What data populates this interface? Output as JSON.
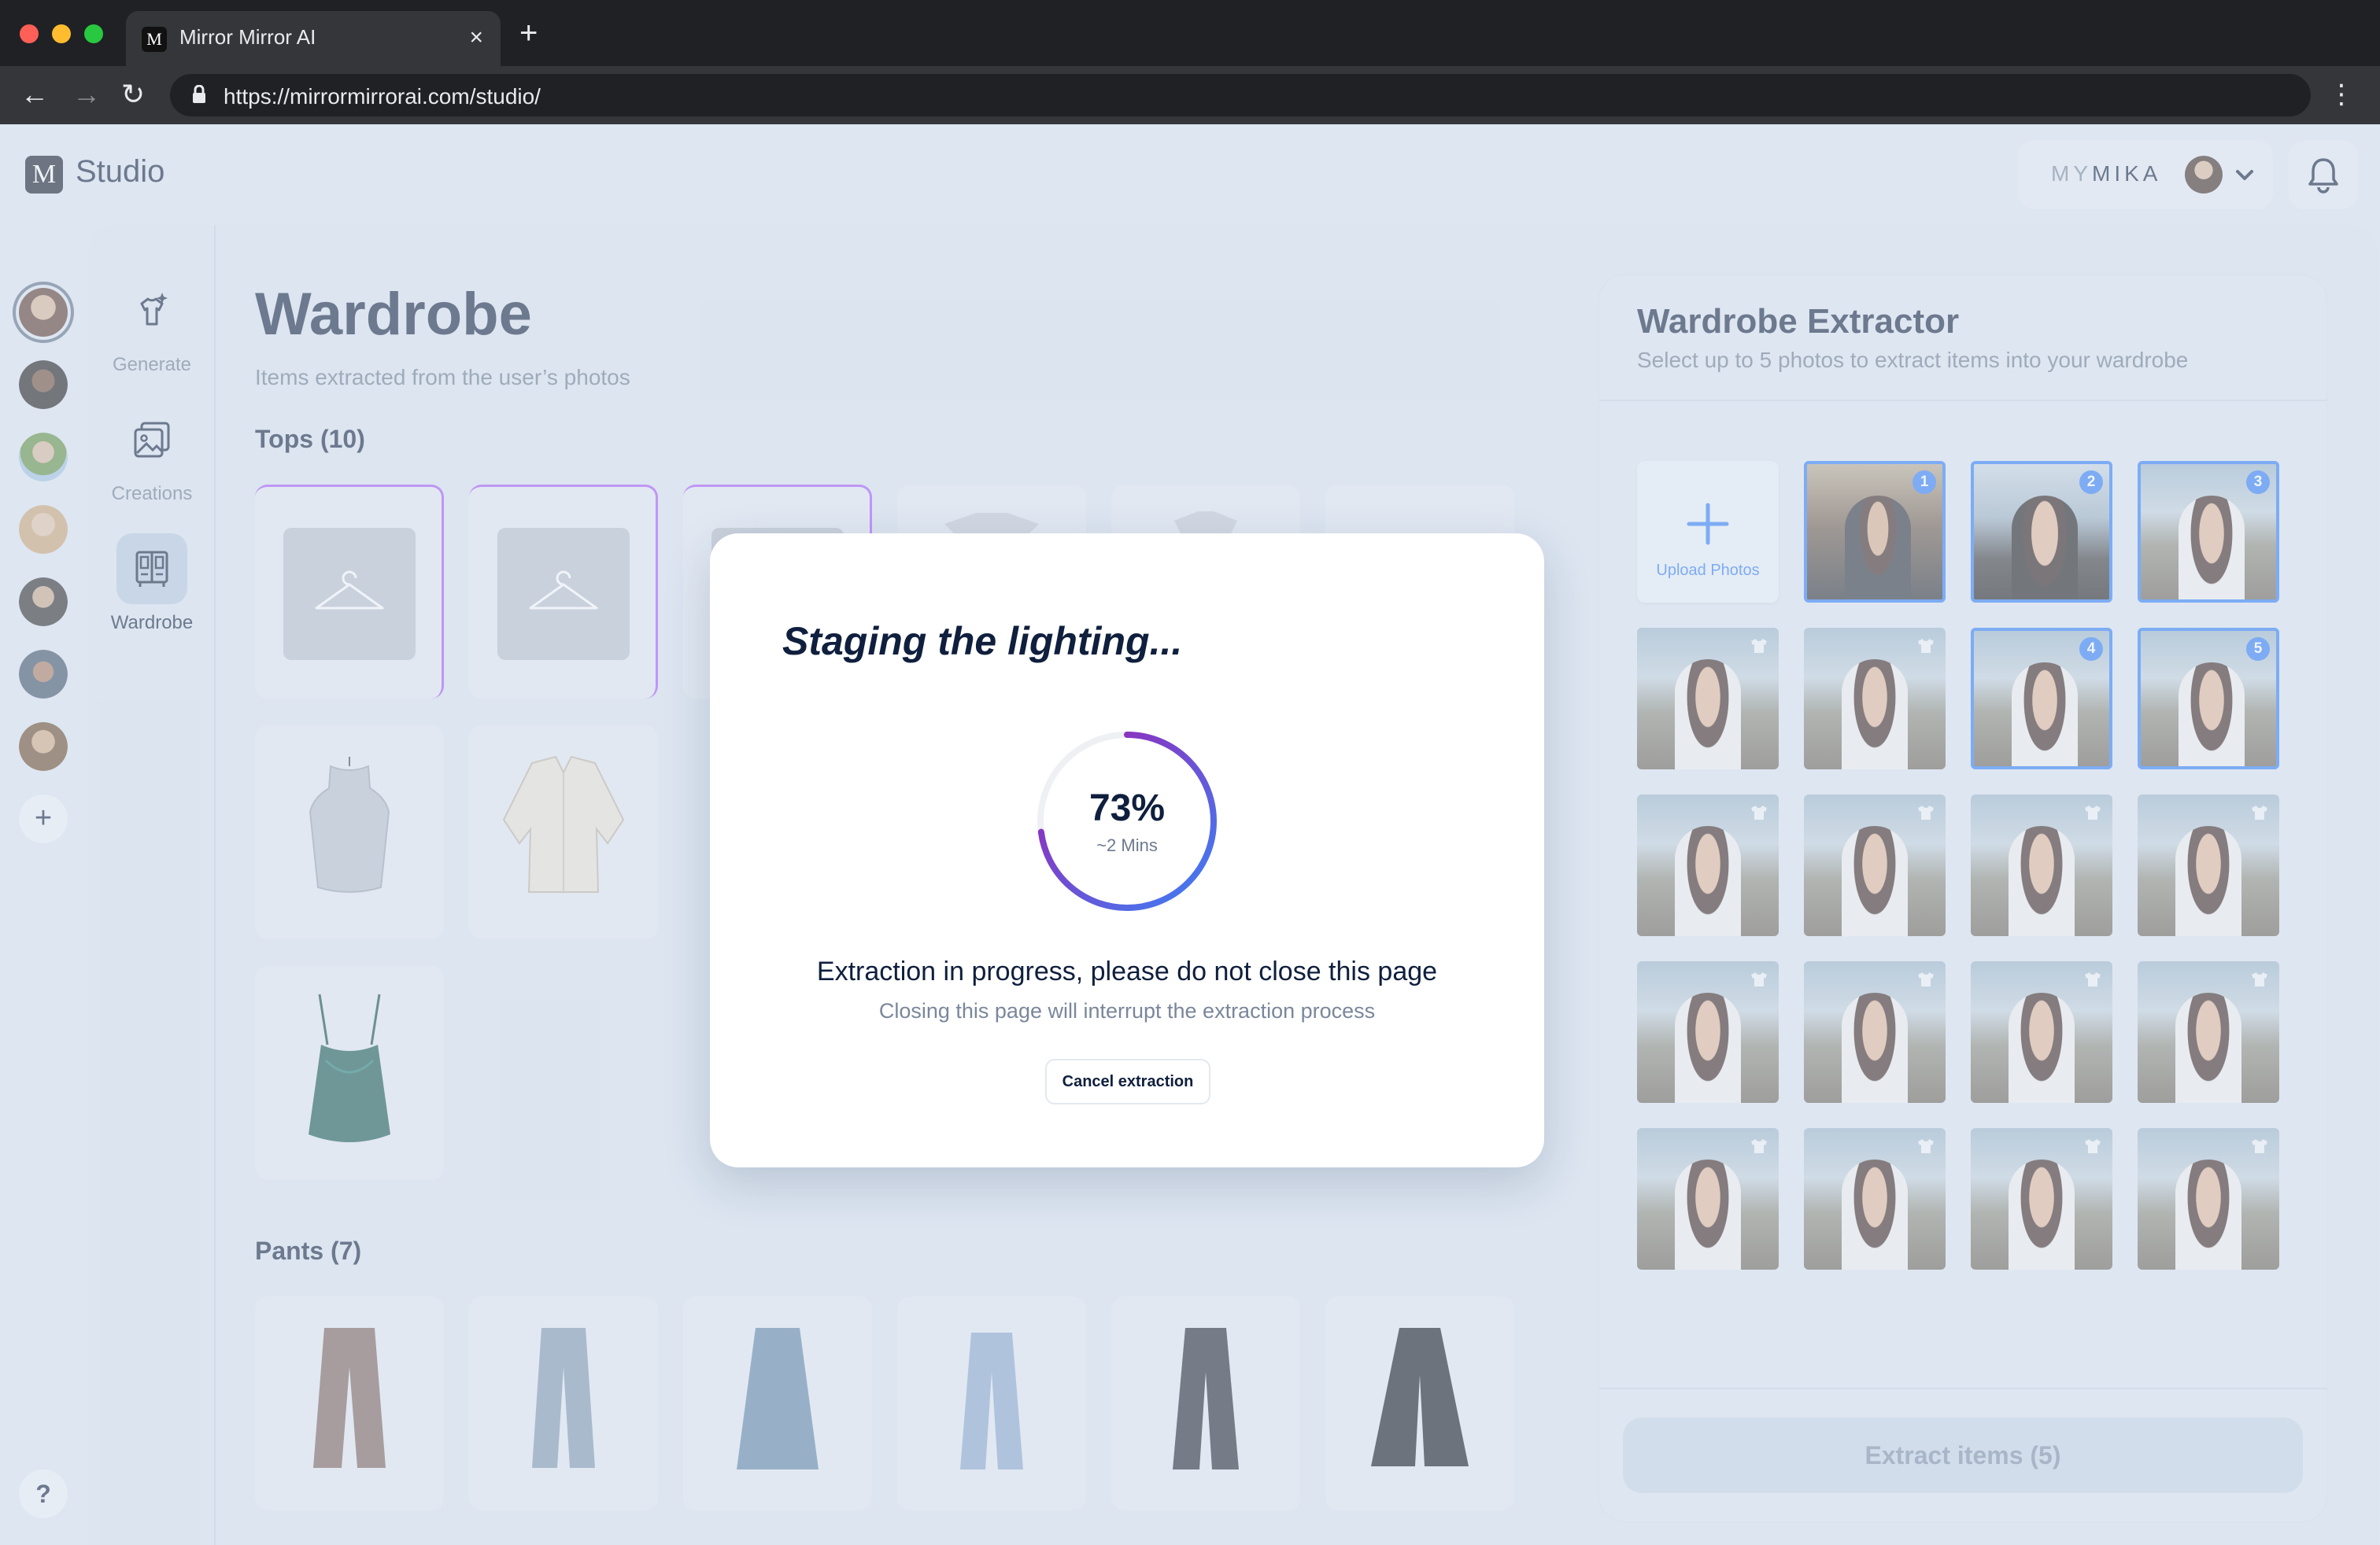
{
  "browser": {
    "tab_title": "Mirror Mirror AI",
    "url": "https://mirrormirrorai.com/studio/"
  },
  "header": {
    "app_title": "Studio",
    "account_prefix": "MY",
    "account_name": "MIKA"
  },
  "nav": {
    "items": [
      {
        "label": "Generate",
        "icon": "generate-icon"
      },
      {
        "label": "Creations",
        "icon": "gallery-icon"
      },
      {
        "label": "Wardrobe",
        "icon": "wardrobe-icon",
        "active": true
      }
    ]
  },
  "profiles": {
    "count": 7,
    "selected_index": 0,
    "help_label": "?"
  },
  "wardrobe": {
    "title": "Wardrobe",
    "subtitle": "Items extracted from the user’s photos",
    "sections": [
      {
        "title": "Tops (10)"
      },
      {
        "title": "Pants (7)"
      }
    ]
  },
  "extractor": {
    "title": "Wardrobe Extractor",
    "subtitle": "Select up to 5 photos to extract items into your wardrobe",
    "upload_label": "Upload Photos",
    "selected_badges": [
      "1",
      "2",
      "3",
      "4",
      "5"
    ],
    "extract_button": "Extract items (5)"
  },
  "modal": {
    "title": "Staging the lighting...",
    "progress": 0.73,
    "progress_label": "73%",
    "eta": "~2 Mins",
    "message": "Extraction in progress, please do not close this page",
    "submessage": "Closing this page will interrupt the extraction process",
    "cancel_label": "Cancel extraction"
  },
  "colors": {
    "accent": "#2f7cf6",
    "brand_dark": "#0f1f3d",
    "progress_start": "#3b82f6",
    "progress_end": "#a21caf",
    "highlight": "#a855f7"
  }
}
